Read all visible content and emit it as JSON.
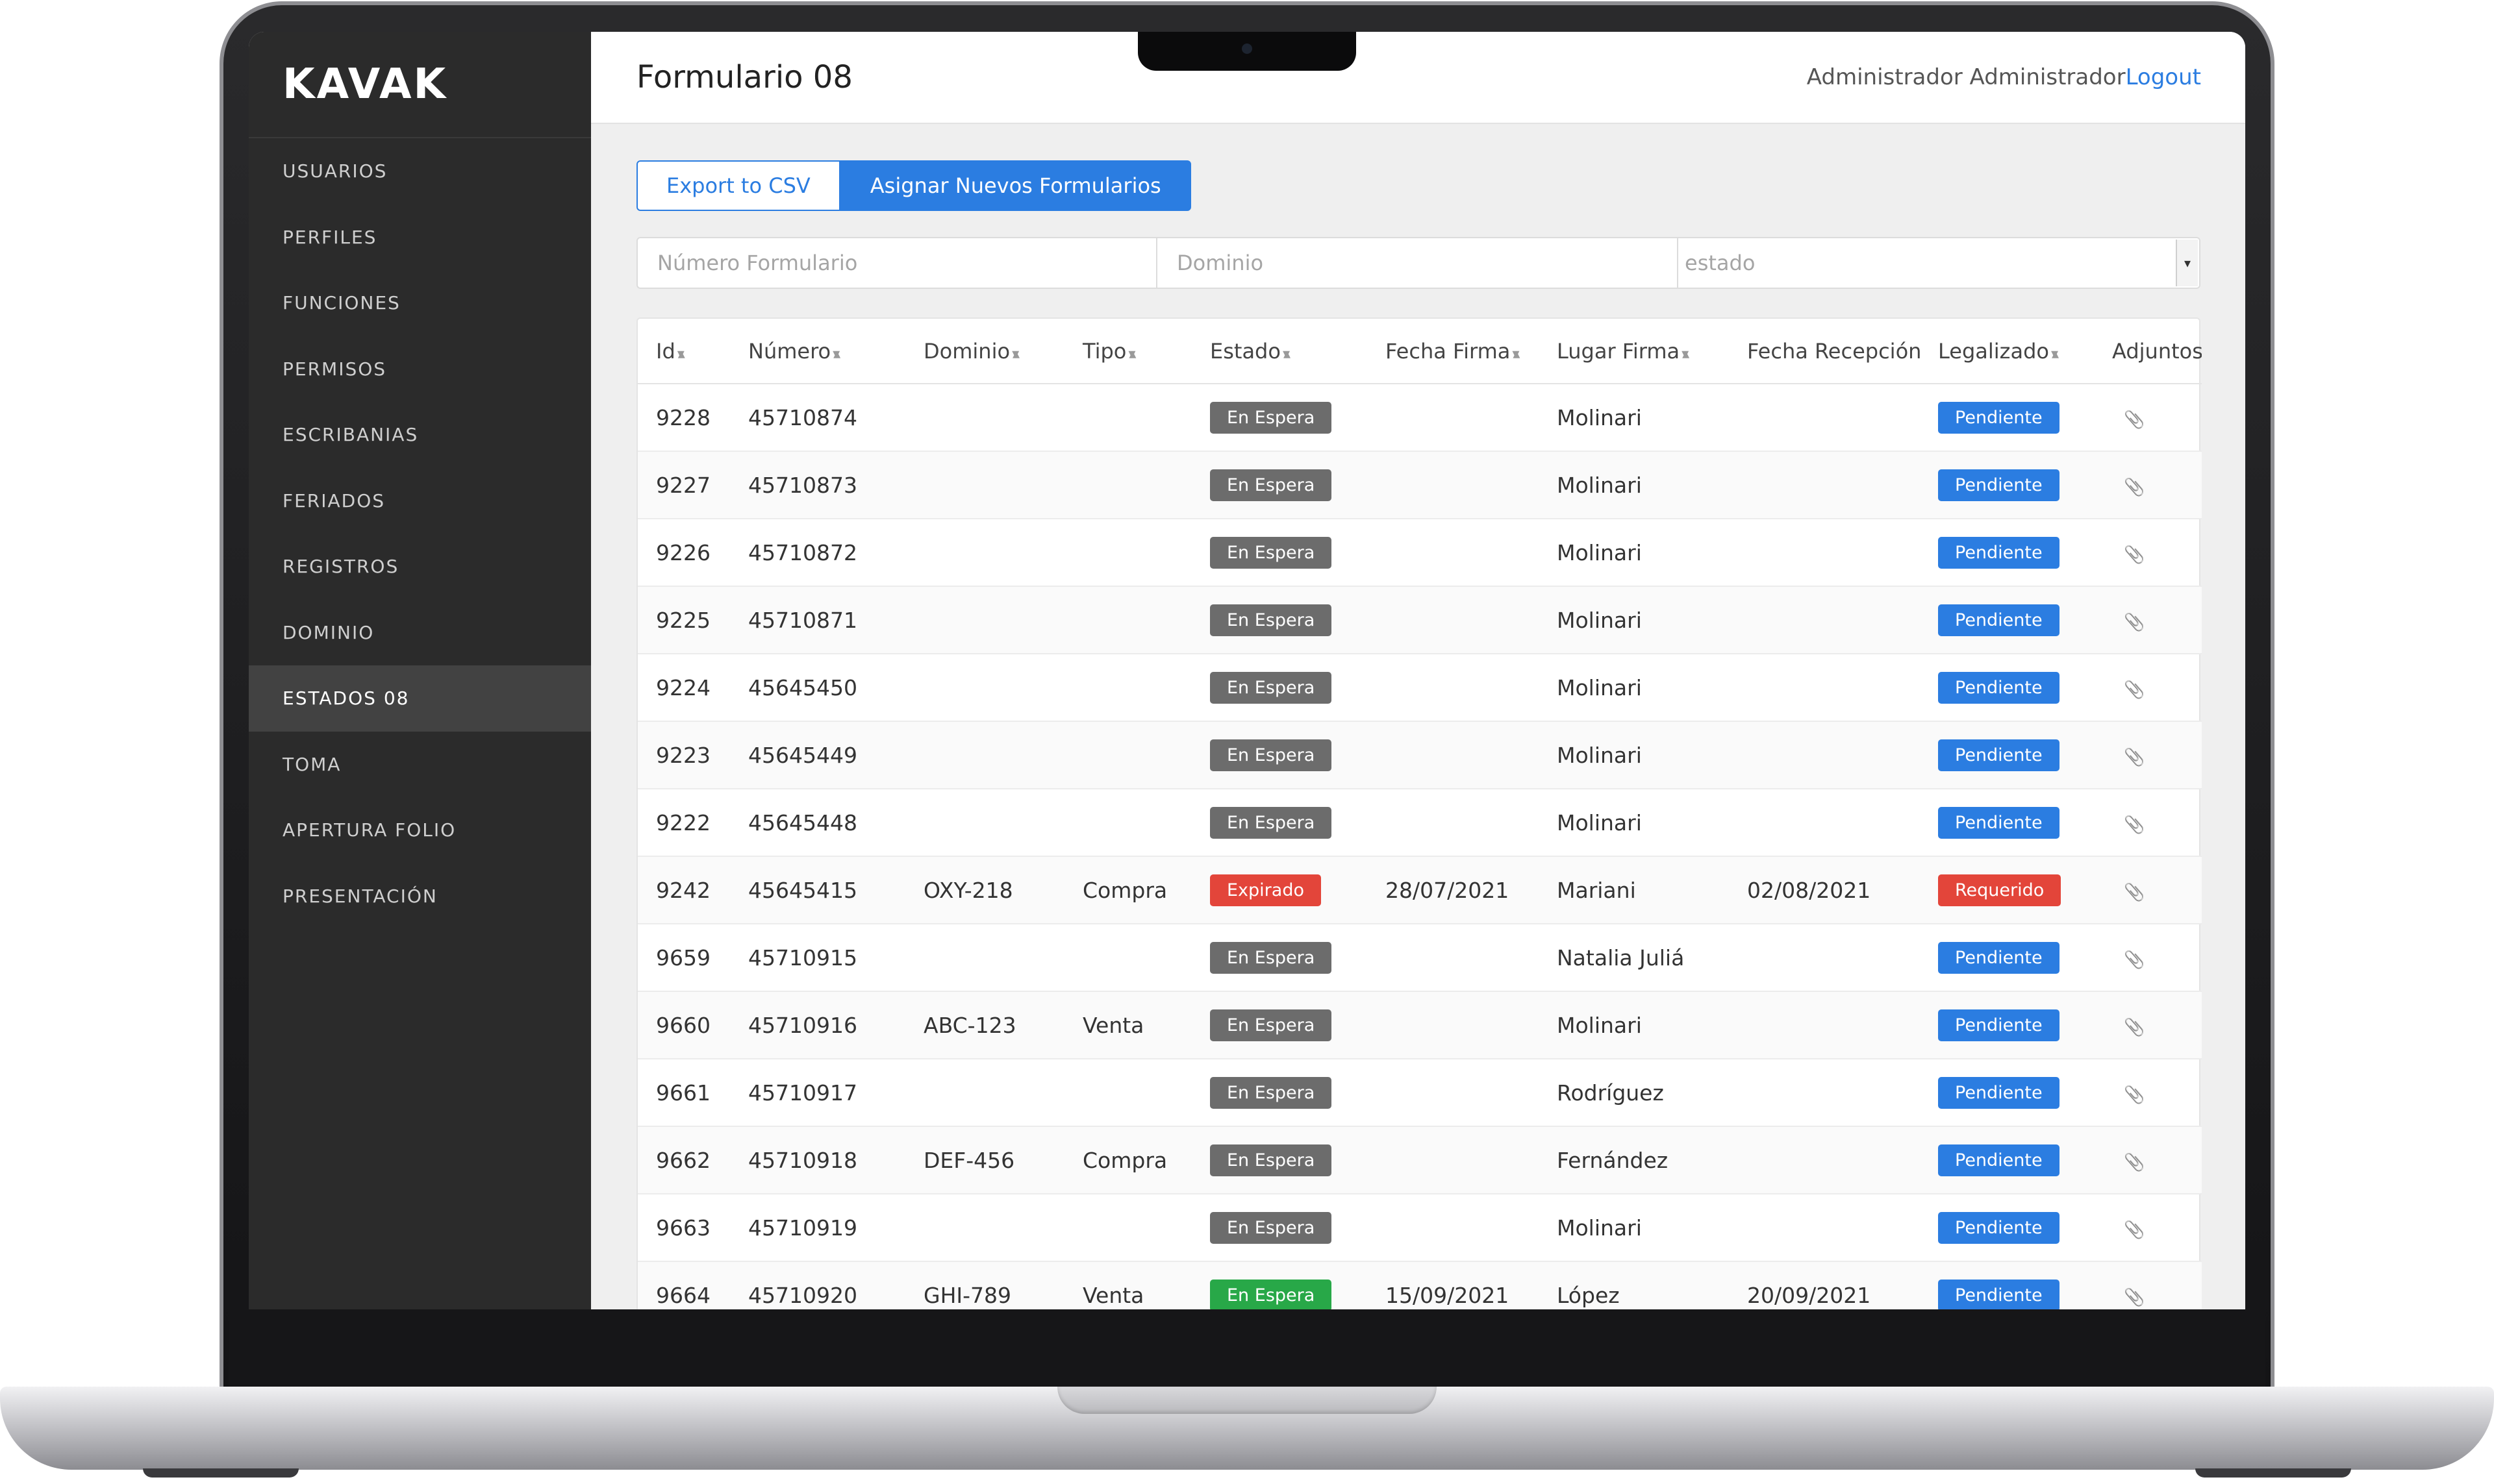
{
  "app": {
    "brand": "KAVAK",
    "page_title": "Formulario 08",
    "user_name": "Administrador Administrador",
    "logout_label": "Logout"
  },
  "sidebar": {
    "items": [
      {
        "label": "USUARIOS",
        "active": false
      },
      {
        "label": "PERFILES",
        "active": false
      },
      {
        "label": "FUNCIONES",
        "active": false
      },
      {
        "label": "PERMISOS",
        "active": false
      },
      {
        "label": "ESCRIBANIAS",
        "active": false
      },
      {
        "label": "FERIADOS",
        "active": false
      },
      {
        "label": "REGISTROS",
        "active": false
      },
      {
        "label": "DOMINIO",
        "active": false
      },
      {
        "label": "ESTADOS 08",
        "active": true
      },
      {
        "label": "TOMA",
        "active": false
      },
      {
        "label": "APERTURA FOLIO",
        "active": false
      },
      {
        "label": "PRESENTACIÓN",
        "active": false
      }
    ]
  },
  "toolbar": {
    "export_label": "Export to CSV",
    "assign_label": "Asignar Nuevos Formularios"
  },
  "filters": {
    "numero_placeholder": "Número Formulario",
    "dominio_placeholder": "Dominio",
    "estado_placeholder": "estado"
  },
  "table": {
    "columns": [
      "Id",
      "Número",
      "Dominio",
      "Tipo",
      "Estado",
      "Fecha Firma",
      "Lugar Firma",
      "Fecha Recepción",
      "Legalizado",
      "Adjuntos"
    ],
    "sortable": [
      true,
      true,
      true,
      true,
      true,
      true,
      true,
      false,
      true,
      false
    ],
    "rows": [
      {
        "id": "9228",
        "numero": "45710874",
        "dominio": "",
        "tipo": "",
        "estado": "En Espera",
        "estado_color": "gray",
        "fecha_firma": "",
        "lugar_firma": "Molinari",
        "fecha_recepcion": "",
        "legalizado": "Pendiente",
        "legalizado_color": "blue",
        "adjunto_icon": "paperclip-icon"
      },
      {
        "id": "9227",
        "numero": "45710873",
        "dominio": "",
        "tipo": "",
        "estado": "En Espera",
        "estado_color": "gray",
        "fecha_firma": "",
        "lugar_firma": "Molinari",
        "fecha_recepcion": "",
        "legalizado": "Pendiente",
        "legalizado_color": "blue",
        "adjunto_icon": "paperclip-icon"
      },
      {
        "id": "9226",
        "numero": "45710872",
        "dominio": "",
        "tipo": "",
        "estado": "En Espera",
        "estado_color": "gray",
        "fecha_firma": "",
        "lugar_firma": "Molinari",
        "fecha_recepcion": "",
        "legalizado": "Pendiente",
        "legalizado_color": "blue",
        "adjunto_icon": "paperclip-icon"
      },
      {
        "id": "9225",
        "numero": "45710871",
        "dominio": "",
        "tipo": "",
        "estado": "En Espera",
        "estado_color": "gray",
        "fecha_firma": "",
        "lugar_firma": "Molinari",
        "fecha_recepcion": "",
        "legalizado": "Pendiente",
        "legalizado_color": "blue",
        "adjunto_icon": "paperclip-icon"
      },
      {
        "id": "9224",
        "numero": "45645450",
        "dominio": "",
        "tipo": "",
        "estado": "En Espera",
        "estado_color": "gray",
        "fecha_firma": "",
        "lugar_firma": "Molinari",
        "fecha_recepcion": "",
        "legalizado": "Pendiente",
        "legalizado_color": "blue",
        "adjunto_icon": "paperclip-icon"
      },
      {
        "id": "9223",
        "numero": "45645449",
        "dominio": "",
        "tipo": "",
        "estado": "En Espera",
        "estado_color": "gray",
        "fecha_firma": "",
        "lugar_firma": "Molinari",
        "fecha_recepcion": "",
        "legalizado": "Pendiente",
        "legalizado_color": "blue",
        "adjunto_icon": "paperclip-icon"
      },
      {
        "id": "9222",
        "numero": "45645448",
        "dominio": "",
        "tipo": "",
        "estado": "En Espera",
        "estado_color": "gray",
        "fecha_firma": "",
        "lugar_firma": "Molinari",
        "fecha_recepcion": "",
        "legalizado": "Pendiente",
        "legalizado_color": "blue",
        "adjunto_icon": "paperclip-icon"
      },
      {
        "id": "9242",
        "numero": "45645415",
        "dominio": "OXY-218",
        "tipo": "Compra",
        "estado": "Expirado",
        "estado_color": "red",
        "fecha_firma": "28/07/2021",
        "lugar_firma": "Mariani",
        "fecha_recepcion": "02/08/2021",
        "legalizado": "Requerido",
        "legalizado_color": "red",
        "adjunto_icon": "paperclip-icon"
      },
      {
        "id": "9659",
        "numero": "45710915",
        "dominio": "",
        "tipo": "",
        "estado": "En Espera",
        "estado_color": "gray",
        "fecha_firma": "",
        "lugar_firma": "Natalia Juliá",
        "fecha_recepcion": "",
        "legalizado": "Pendiente",
        "legalizado_color": "blue",
        "adjunto_icon": "paperclip-icon"
      },
      {
        "id": "9660",
        "numero": "45710916",
        "dominio": "ABC-123",
        "tipo": "Venta",
        "estado": "En Espera",
        "estado_color": "gray",
        "fecha_firma": "",
        "lugar_firma": "Molinari",
        "fecha_recepcion": "",
        "legalizado": "Pendiente",
        "legalizado_color": "blue",
        "adjunto_icon": "paperclip-icon"
      },
      {
        "id": "9661",
        "numero": "45710917",
        "dominio": "",
        "tipo": "",
        "estado": "En Espera",
        "estado_color": "gray",
        "fecha_firma": "",
        "lugar_firma": "Rodríguez",
        "fecha_recepcion": "",
        "legalizado": "Pendiente",
        "legalizado_color": "blue",
        "adjunto_icon": "paperclip-icon"
      },
      {
        "id": "9662",
        "numero": "45710918",
        "dominio": "DEF-456",
        "tipo": "Compra",
        "estado": "En Espera",
        "estado_color": "gray",
        "fecha_firma": "",
        "lugar_firma": "Fernández",
        "fecha_recepcion": "",
        "legalizado": "Pendiente",
        "legalizado_color": "blue",
        "adjunto_icon": "paperclip-icon"
      },
      {
        "id": "9663",
        "numero": "45710919",
        "dominio": "",
        "tipo": "",
        "estado": "En Espera",
        "estado_color": "gray",
        "fecha_firma": "",
        "lugar_firma": "Molinari",
        "fecha_recepcion": "",
        "legalizado": "Pendiente",
        "legalizado_color": "blue",
        "adjunto_icon": "paperclip-icon"
      },
      {
        "id": "9664",
        "numero": "45710920",
        "dominio": "GHI-789",
        "tipo": "Venta",
        "estado": "En Espera",
        "estado_color": "green",
        "fecha_firma": "15/09/2021",
        "lugar_firma": "López",
        "fecha_recepcion": "20/09/2021",
        "legalizado": "Pendiente",
        "legalizado_color": "blue",
        "adjunto_icon": "paperclip-icon"
      }
    ]
  },
  "colors": {
    "accent": "#2b7de1",
    "sidebar_bg": "#2b2b2b",
    "badge_gray": "#6c6c6c",
    "badge_red": "#e3453a",
    "badge_green": "#28a848"
  }
}
